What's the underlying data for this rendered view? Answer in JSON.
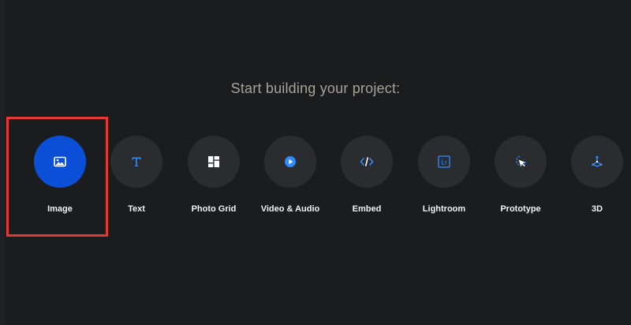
{
  "prompt": {
    "heading": "Start building your project:"
  },
  "tools": [
    {
      "label": "Image",
      "icon": "image-icon",
      "active": true
    },
    {
      "label": "Text",
      "icon": "text-icon",
      "active": false
    },
    {
      "label": "Photo Grid",
      "icon": "photo-grid-icon",
      "active": false
    },
    {
      "label": "Video & Audio",
      "icon": "play-icon",
      "active": false
    },
    {
      "label": "Embed",
      "icon": "code-icon",
      "active": false
    },
    {
      "label": "Lightroom",
      "icon": "lightroom-icon",
      "active": false
    },
    {
      "label": "Prototype",
      "icon": "cursor-click-icon",
      "active": false
    },
    {
      "label": "3D",
      "icon": "3d-icon",
      "active": false
    }
  ],
  "icon_glyphs": {
    "lightroom": "Lr"
  },
  "colors": {
    "background": "#1b1c1e",
    "tile": "#2b2c2f",
    "active_tile": "#0a4fd6",
    "icon_accent": "#2f8cff",
    "heading_text": "#a8a297",
    "label_text": "#f2f2f2",
    "highlight": "#e53935"
  }
}
